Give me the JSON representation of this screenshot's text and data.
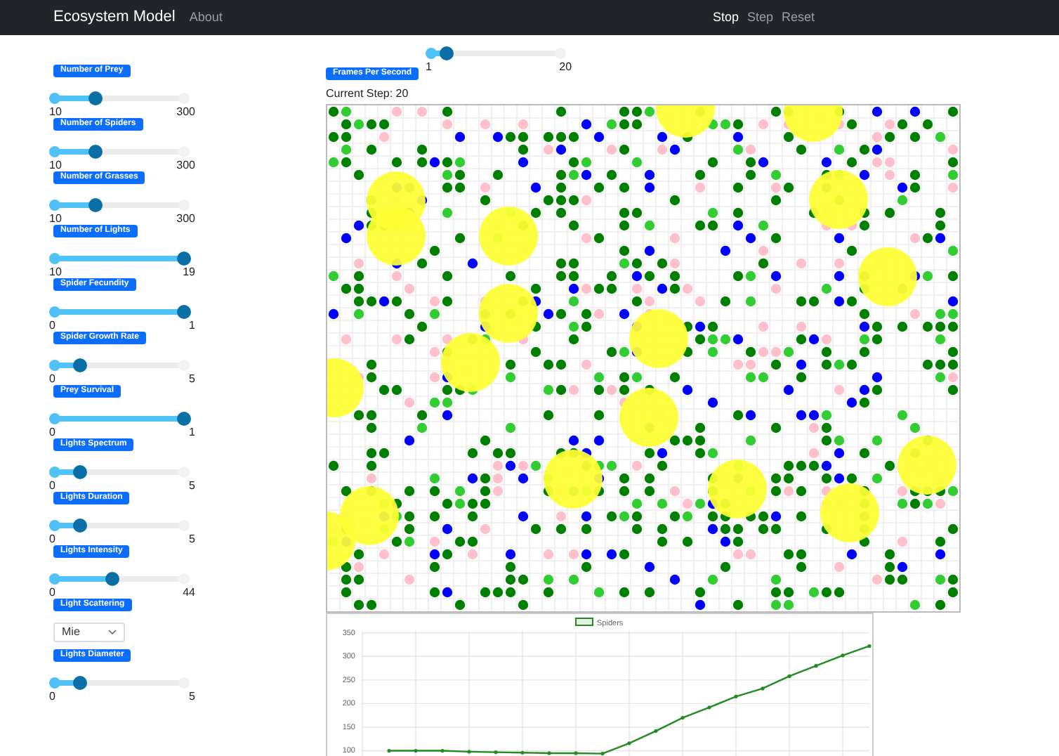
{
  "navbar": {
    "brand": "Ecosystem Model",
    "links": [
      {
        "label": "About"
      }
    ],
    "controls": [
      {
        "label": "Stop",
        "active": true
      },
      {
        "label": "Step",
        "active": false
      },
      {
        "label": "Reset",
        "active": false
      }
    ]
  },
  "sidebar": {
    "controls": [
      {
        "kind": "slider",
        "label": "Number of Prey",
        "min": "10",
        "max": "300",
        "level": 0.31
      },
      {
        "kind": "slider",
        "label": "Number of Spiders",
        "min": "10",
        "max": "300",
        "level": 0.31
      },
      {
        "kind": "slider",
        "label": "Number of Grasses",
        "min": "10",
        "max": "300",
        "level": 0.31
      },
      {
        "kind": "slider",
        "label": "Number of Lights",
        "min": "10",
        "max": "19",
        "level": 1
      },
      {
        "kind": "slider",
        "label": "Spider Fecundity",
        "min": "0",
        "max": "1",
        "level": 1
      },
      {
        "kind": "slider",
        "label": "Spider Growth Rate",
        "min": "0",
        "max": "5",
        "level": 0.2
      },
      {
        "kind": "slider",
        "label": "Prey Survival",
        "min": "0",
        "max": "1",
        "level": 1
      },
      {
        "kind": "slider",
        "label": "Lights Spectrum",
        "min": "0",
        "max": "5",
        "level": 0.2
      },
      {
        "kind": "slider",
        "label": "Lights Duration",
        "min": "0",
        "max": "5",
        "level": 0.2
      },
      {
        "kind": "slider",
        "label": "Lights Intensity",
        "min": "0",
        "max": "44",
        "level": 0.45
      },
      {
        "kind": "select",
        "label": "Light Scattering",
        "value": "Mie"
      },
      {
        "kind": "slider",
        "label": "Lights Diameter",
        "min": "0",
        "max": "5",
        "level": 0.2
      }
    ]
  },
  "main": {
    "fps": {
      "label": "Frames Per Second",
      "min": "1",
      "max": "20",
      "level": 0.12
    },
    "current_step": "Current Step: 20",
    "chart_data": {
      "type": "line",
      "grid": true,
      "ylim": [
        80,
        354
      ],
      "yticks": [
        100,
        150,
        200,
        250,
        300,
        350
      ],
      "series": [
        {
          "name": "Spiders",
          "color": "#228b22",
          "values": [
            null,
            100,
            100,
            100,
            98,
            97,
            96,
            95,
            95,
            94,
            116,
            142,
            170,
            192,
            215,
            232,
            258,
            280,
            302,
            322
          ]
        }
      ]
    }
  }
}
